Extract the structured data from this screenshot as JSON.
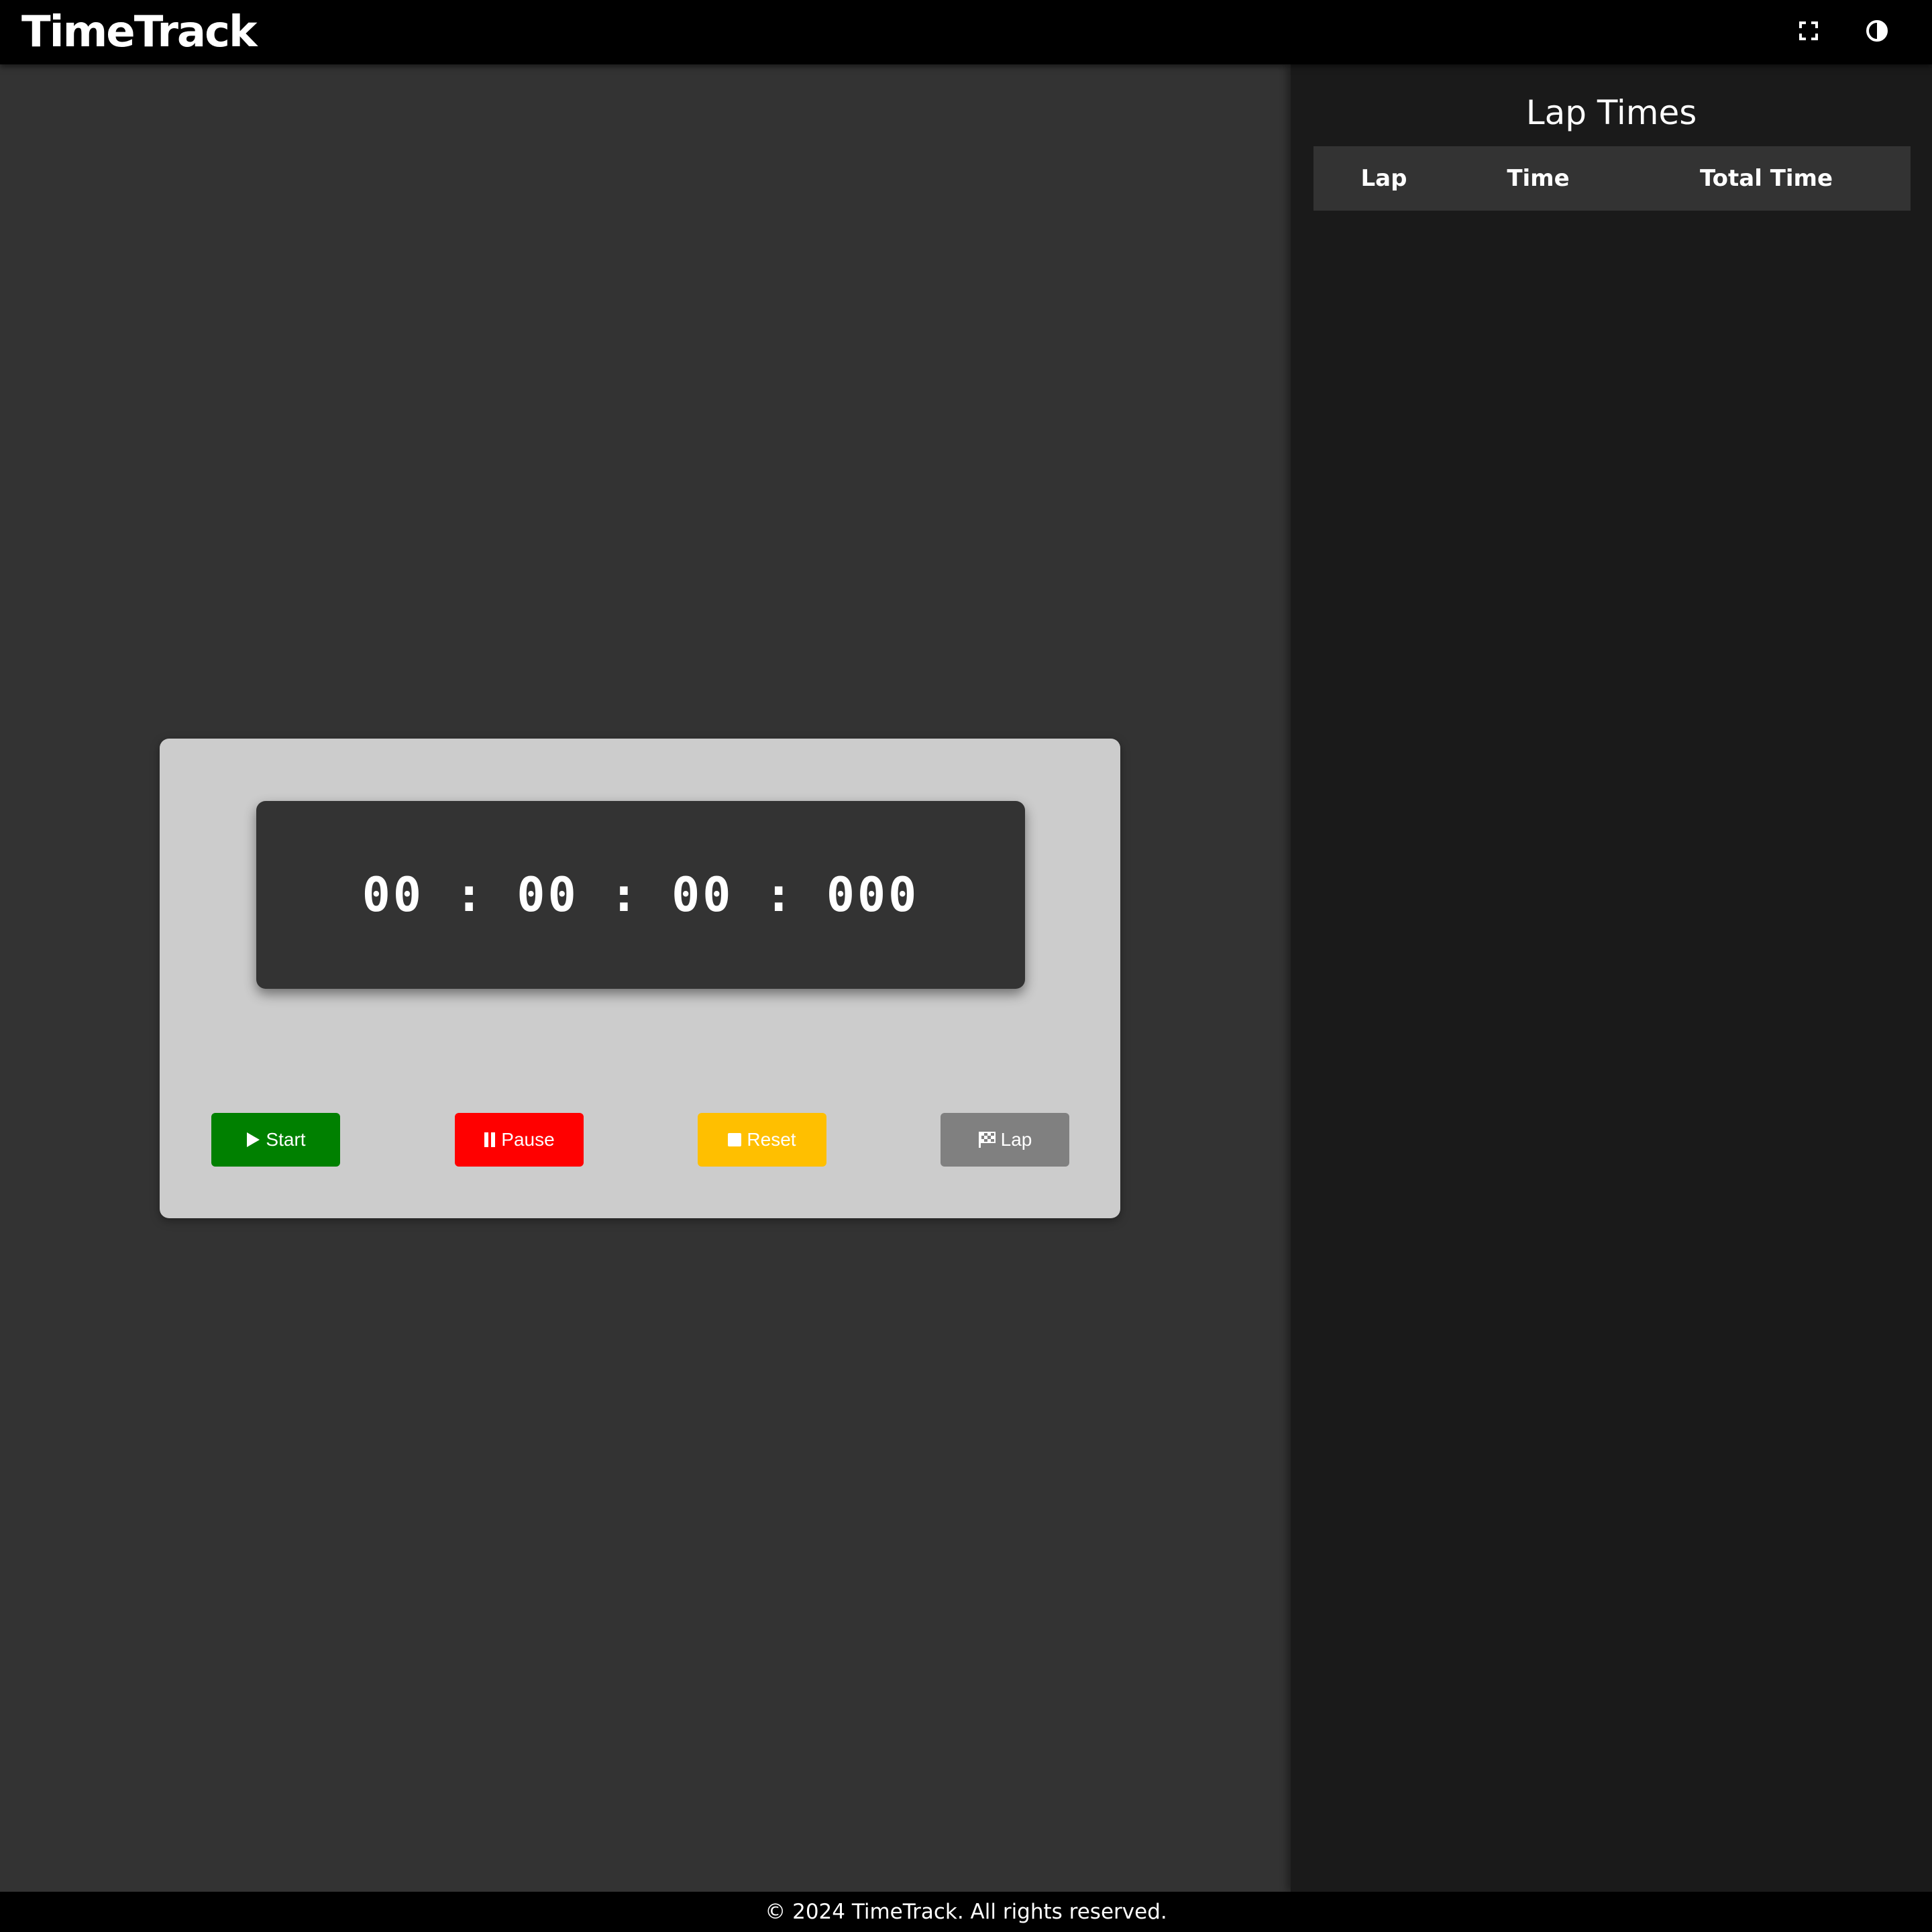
{
  "header": {
    "brand": "TimeTrack",
    "icons": [
      "fullscreen-icon",
      "contrast-icon"
    ]
  },
  "stopwatch": {
    "display": "00 : 00 : 00 : 000",
    "buttons": {
      "start_label": "Start",
      "pause_label": "Pause",
      "reset_label": "Reset",
      "lap_label": "Lap"
    },
    "colors": {
      "start": "#008000",
      "pause": "#ff0000",
      "reset": "#ffbf00",
      "lap": "#808080"
    }
  },
  "lap_panel": {
    "title": "Lap Times",
    "columns": [
      "Lap",
      "Time",
      "Total Time"
    ],
    "rows": []
  },
  "footer": {
    "text": "© 2024 TimeTrack. All rights reserved."
  }
}
